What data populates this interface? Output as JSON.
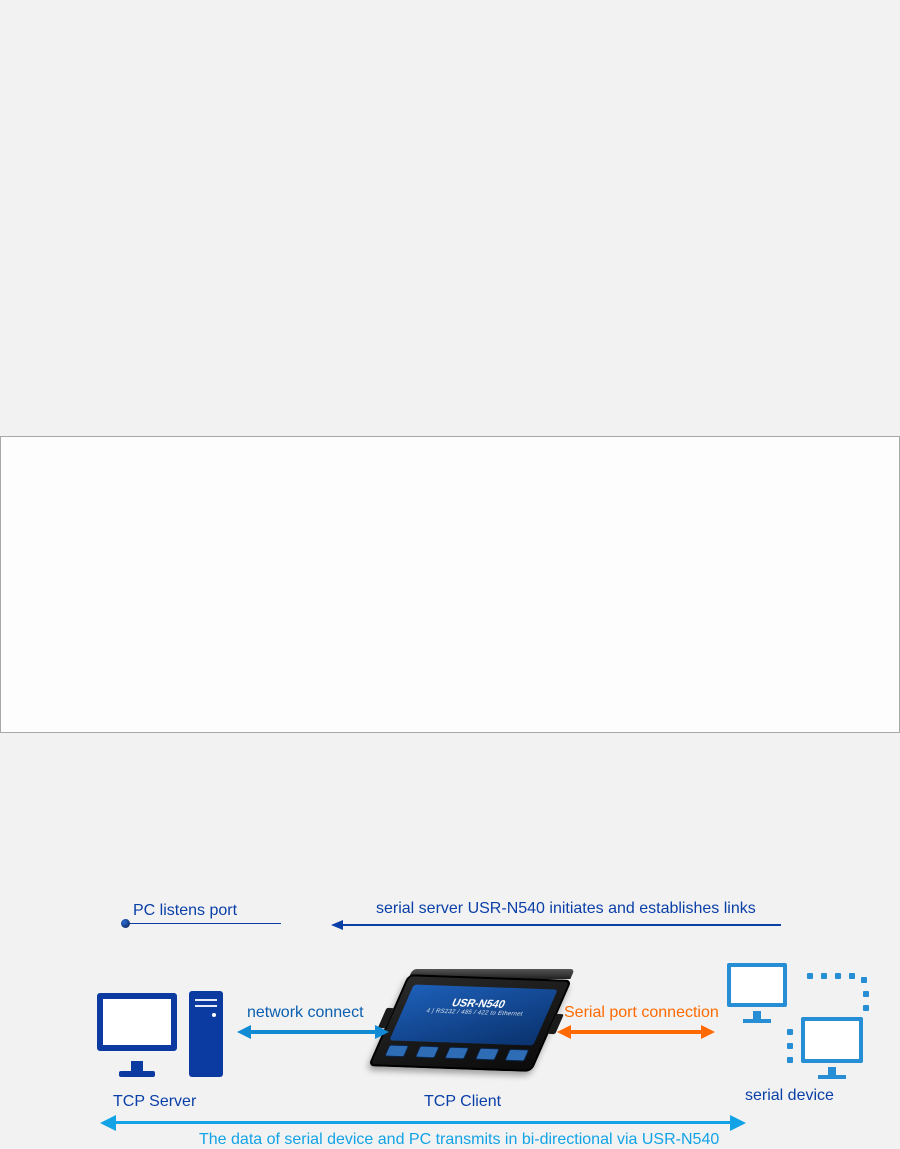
{
  "top": {
    "pc_listens": "PC listens  port",
    "server_initiates": "serial server USR-N540 initiates and establishes links"
  },
  "arrow_labels": {
    "network_connect": "network connect",
    "serial_port": "Serial port connection"
  },
  "roles": {
    "tcp_server": "TCP Server",
    "tcp_client": "TCP Client",
    "serial_device": "serial device"
  },
  "device": {
    "model": "USR-N540",
    "subtitle": "4 | RS232 / 485 / 422 to Ethernet"
  },
  "bottom_caption": "The data of serial device and PC transmits in bi-directional via USR-N540"
}
